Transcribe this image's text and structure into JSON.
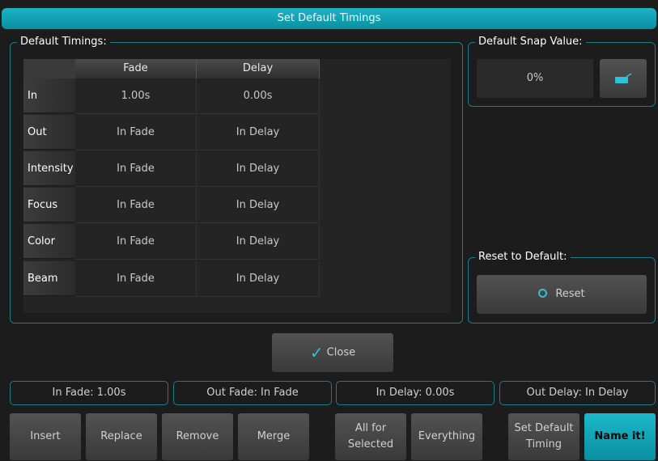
{
  "window": {
    "title": "Set Default Timings"
  },
  "timings": {
    "group_label": "Default Timings:",
    "columns": [
      "Fade",
      "Delay"
    ],
    "rows": [
      {
        "label": "In",
        "fade": "1.00s",
        "delay": "0.00s"
      },
      {
        "label": "Out",
        "fade": "In Fade",
        "delay": "In Delay"
      },
      {
        "label": "Intensity",
        "fade": "In Fade",
        "delay": "In Delay"
      },
      {
        "label": "Focus",
        "fade": "In Fade",
        "delay": "In Delay"
      },
      {
        "label": "Color",
        "fade": "In Fade",
        "delay": "In Delay"
      },
      {
        "label": "Beam",
        "fade": "In Fade",
        "delay": "In Delay"
      }
    ]
  },
  "snap": {
    "group_label": "Default Snap Value:",
    "value": "0%",
    "edit_icon": "keyboard-icon"
  },
  "reset": {
    "group_label": "Reset to Default:",
    "button_label": "Reset",
    "icon": "refresh-icon"
  },
  "close": {
    "label": "Close",
    "icon": "checkmark-icon"
  },
  "status": {
    "in_fade": "In Fade: 1.00s",
    "out_fade": "Out Fade: In Fade",
    "in_delay": "In Delay: 0.00s",
    "out_delay": "Out Delay: In Delay"
  },
  "toolbar": {
    "insert": "Insert",
    "replace": "Replace",
    "remove": "Remove",
    "merge": "Merge",
    "all_for_selected": "All for\nSelected",
    "everything": "Everything",
    "set_default_timing": "Set Default\nTiming",
    "name_it": "Name it!"
  },
  "colors": {
    "accent": "#0fa3b4",
    "border": "#187d8b",
    "background": "#1c1c1c"
  }
}
